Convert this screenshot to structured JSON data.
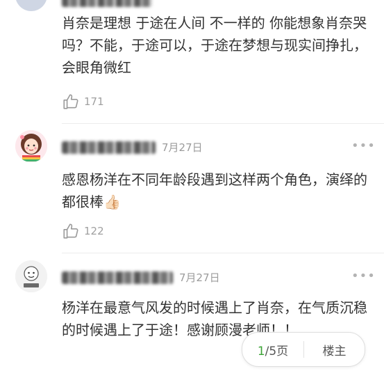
{
  "comments": [
    {
      "text": "肖奈是理想 于途在人间 不一样的 你能想象肖奈哭吗？不能，于途可以，于途在梦想与现实间挣扎，会眼角微红",
      "likes": "171"
    },
    {
      "date": "7月27日",
      "text": "感恩杨洋在不同年龄段遇到这样两个角色，演绎的都很棒👍🏻",
      "likes": "122"
    },
    {
      "date": "7月27日",
      "text": "杨洋在最意气风发的时候遇上了肖奈，在气质沉稳的时候遇上了于途！感谢顾漫老师！！"
    }
  ],
  "more_label": "•••",
  "pager": {
    "current": "1",
    "total_label": "/5页",
    "owner_label": "楼主"
  }
}
